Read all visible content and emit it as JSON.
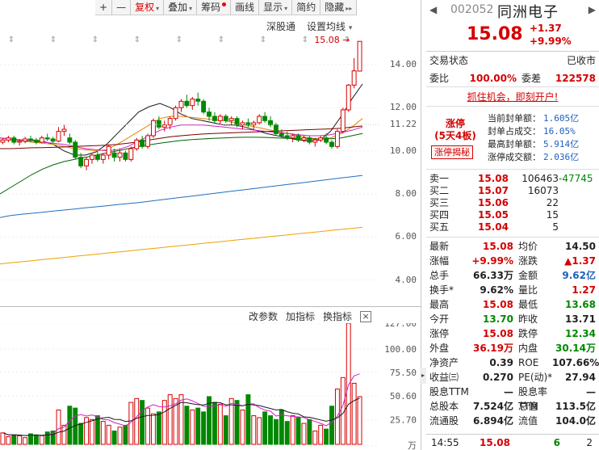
{
  "toolbar": {
    "items": [
      {
        "label": "+",
        "name": "zoom-in-button"
      },
      {
        "label": "—",
        "name": "zoom-out-button"
      },
      {
        "label": "复权",
        "name": "fuquan-dropdown",
        "caret": "▾",
        "red": true
      },
      {
        "label": "叠加",
        "name": "overlay-dropdown",
        "caret": "▾"
      },
      {
        "label": "筹码",
        "name": "chips-button",
        "dot": true
      },
      {
        "label": "画线",
        "name": "draw-line-button"
      },
      {
        "label": "显示",
        "name": "display-dropdown",
        "caret": "▾"
      },
      {
        "label": "简约",
        "name": "simple-button"
      },
      {
        "label": "隐藏",
        "name": "hide-button",
        "caret": "▸▸"
      }
    ]
  },
  "kline": {
    "index_label": "深股通",
    "ma_setting": "设置均线",
    "ma_caret": "▾",
    "price_ticks": [
      "14.00",
      "12.00",
      "11.22",
      "10.00",
      "8.00",
      "6.00",
      "4.00"
    ],
    "top_price_label": "15.08"
  },
  "volume": {
    "menu": [
      "改参数",
      "加指标",
      "换指标"
    ],
    "close": "×",
    "ticks": [
      "127.00",
      "100.00",
      "75.50",
      "50.60",
      "25.70",
      "万"
    ]
  },
  "chart_data": {
    "type": "candlestick",
    "ylim_price": [
      3.5,
      15.5
    ],
    "ylim_volume": [
      0,
      127
    ],
    "candles": [
      [
        10.4,
        10.6,
        10.3,
        10.5
      ],
      [
        10.5,
        10.7,
        10.4,
        10.6
      ],
      [
        10.6,
        10.7,
        10.3,
        10.4
      ],
      [
        10.4,
        10.55,
        10.25,
        10.45
      ],
      [
        10.45,
        10.65,
        10.35,
        10.55
      ],
      [
        10.55,
        10.7,
        10.4,
        10.5
      ],
      [
        10.5,
        10.6,
        10.3,
        10.4
      ],
      [
        10.4,
        10.7,
        10.35,
        10.6
      ],
      [
        10.6,
        10.8,
        10.45,
        10.55
      ],
      [
        10.55,
        10.65,
        10.35,
        10.45
      ],
      [
        10.45,
        11.1,
        10.4,
        10.9
      ],
      [
        10.9,
        11.2,
        10.7,
        11.0
      ],
      [
        10.6,
        10.8,
        10.3,
        10.4
      ],
      [
        10.4,
        10.5,
        9.6,
        9.7
      ],
      [
        9.7,
        9.9,
        9.2,
        9.3
      ],
      [
        9.3,
        9.7,
        9.1,
        9.6
      ],
      [
        9.6,
        9.9,
        9.4,
        9.8
      ],
      [
        9.8,
        10.0,
        9.5,
        9.6
      ],
      [
        9.6,
        9.9,
        9.4,
        9.8
      ],
      [
        9.8,
        10.3,
        9.6,
        10.2
      ],
      [
        9.9,
        10.1,
        9.5,
        9.7
      ],
      [
        9.7,
        10.1,
        9.5,
        9.9
      ],
      [
        9.9,
        10.0,
        9.5,
        9.6
      ],
      [
        9.6,
        10.2,
        9.5,
        10.1
      ],
      [
        10.1,
        10.6,
        10.0,
        10.5
      ],
      [
        10.5,
        10.7,
        10.1,
        10.2
      ],
      [
        10.2,
        10.8,
        10.1,
        10.7
      ],
      [
        10.7,
        11.5,
        10.6,
        11.4
      ],
      [
        11.4,
        11.6,
        11.0,
        11.1
      ],
      [
        11.1,
        11.4,
        10.9,
        11.2
      ],
      [
        11.2,
        11.6,
        11.0,
        11.5
      ],
      [
        11.5,
        12.1,
        11.4,
        12.0
      ],
      [
        12.0,
        12.4,
        11.8,
        12.3
      ],
      [
        12.3,
        12.6,
        12.0,
        12.1
      ],
      [
        12.1,
        12.5,
        11.9,
        12.4
      ],
      [
        12.4,
        12.7,
        12.1,
        12.3
      ],
      [
        12.3,
        12.4,
        11.7,
        11.8
      ],
      [
        11.8,
        12.0,
        11.4,
        11.6
      ],
      [
        11.6,
        11.8,
        11.3,
        11.4
      ],
      [
        11.4,
        11.7,
        11.2,
        11.6
      ],
      [
        11.6,
        11.7,
        11.3,
        11.4
      ],
      [
        11.4,
        11.6,
        11.2,
        11.5
      ],
      [
        11.5,
        11.6,
        11.1,
        11.2
      ],
      [
        11.2,
        11.4,
        11.0,
        11.3
      ],
      [
        11.3,
        11.5,
        11.1,
        11.2
      ],
      [
        11.2,
        11.4,
        11.0,
        11.3
      ],
      [
        11.3,
        11.7,
        11.2,
        11.6
      ],
      [
        11.6,
        11.8,
        11.3,
        11.4
      ],
      [
        11.4,
        11.6,
        11.1,
        11.2
      ],
      [
        11.2,
        11.3,
        10.7,
        10.8
      ],
      [
        10.8,
        11.0,
        10.6,
        10.7
      ],
      [
        10.7,
        10.9,
        10.5,
        10.6
      ],
      [
        10.6,
        10.8,
        10.4,
        10.7
      ],
      [
        10.7,
        10.8,
        10.4,
        10.5
      ],
      [
        10.5,
        10.7,
        10.4,
        10.6
      ],
      [
        10.6,
        10.7,
        10.3,
        10.4
      ],
      [
        10.4,
        10.6,
        10.2,
        10.5
      ],
      [
        10.5,
        10.7,
        10.4,
        10.6
      ],
      [
        10.6,
        10.8,
        10.3,
        10.4
      ],
      [
        10.4,
        10.5,
        10.1,
        10.2
      ],
      [
        10.2,
        11.0,
        10.1,
        10.9
      ],
      [
        10.9,
        12.0,
        10.8,
        11.9
      ],
      [
        11.9,
        13.1,
        11.8,
        13.05
      ],
      [
        13.05,
        14.3,
        12.9,
        13.71
      ],
      [
        13.7,
        15.08,
        13.68,
        15.08
      ]
    ],
    "volumes": [
      12,
      8,
      10,
      9,
      7,
      11,
      10,
      9,
      13,
      14,
      36,
      20,
      40,
      38,
      22,
      28,
      26,
      30,
      24,
      20,
      14,
      18,
      20,
      44,
      48,
      46,
      38,
      32,
      34,
      46,
      52,
      48,
      52,
      40,
      36,
      38,
      34,
      50,
      44,
      42,
      30,
      48,
      46,
      36,
      52,
      30,
      28,
      34,
      30,
      26,
      36,
      24,
      30,
      28,
      22,
      26,
      14,
      20,
      16,
      40,
      58,
      70,
      127,
      64,
      50
    ],
    "moving_averages": [
      {
        "color": "#1a1a1a",
        "values": [
          10.6,
          10.55,
          10.5,
          10.5,
          10.45,
          10.3,
          10.0,
          9.8,
          9.8,
          9.95,
          10.3,
          10.8,
          11.3,
          11.8,
          12.05,
          12.2,
          12.0,
          11.7,
          11.5,
          11.4,
          11.3,
          11.2,
          11.2,
          11.1,
          10.95,
          10.8,
          10.7,
          10.6,
          10.5,
          10.45,
          10.5,
          10.9,
          11.6,
          12.4,
          13.1
        ]
      },
      {
        "color": "#e08a00",
        "values": [
          10.5,
          10.5,
          10.45,
          10.4,
          10.35,
          10.3,
          10.2,
          10.1,
          10.05,
          10.0,
          10.05,
          10.3,
          10.6,
          10.9,
          11.2,
          11.5,
          11.6,
          11.6,
          11.55,
          11.5,
          11.45,
          11.4,
          11.3,
          11.2,
          11.1,
          11.0,
          10.9,
          10.8,
          10.7,
          10.6,
          10.55,
          10.6,
          10.8,
          11.1,
          11.5
        ]
      },
      {
        "color": "#d020c8",
        "values": [
          10.6,
          10.55,
          10.5,
          10.45,
          10.4,
          10.35,
          10.3,
          10.2,
          10.1,
          10.05,
          10.0,
          10.05,
          10.2,
          10.45,
          10.7,
          10.95,
          11.1,
          11.2,
          11.2,
          11.2,
          11.15,
          11.1,
          11.05,
          11.0,
          10.95,
          10.9,
          10.85,
          10.8,
          10.75,
          10.7,
          10.7,
          10.75,
          10.85,
          10.95,
          11.1
        ]
      },
      {
        "color": "#7a0000",
        "values": [
          10.1,
          10.1,
          10.12,
          10.14,
          10.15,
          10.16,
          10.18,
          10.2,
          10.22,
          10.24,
          10.26,
          10.3,
          10.35,
          10.42,
          10.5,
          10.58,
          10.65,
          10.7,
          10.74,
          10.78,
          10.8,
          10.82,
          10.84,
          10.86,
          10.88,
          10.9,
          10.92,
          10.94,
          10.96,
          10.98,
          11.0,
          11.02,
          11.05,
          11.1,
          11.15
        ]
      },
      {
        "color": "#006400",
        "values": [
          8.0,
          8.3,
          8.6,
          8.9,
          9.15,
          9.35,
          9.5,
          9.6,
          9.7,
          9.8,
          9.9,
          10.0,
          10.1,
          10.2,
          10.28,
          10.35,
          10.42,
          10.48,
          10.52,
          10.55,
          10.58,
          10.6,
          10.62,
          10.63,
          10.63,
          10.62,
          10.6,
          10.58,
          10.56,
          10.55,
          10.55,
          10.56,
          10.6,
          10.7,
          10.8
        ]
      },
      {
        "color": "#1f6fbf",
        "values": [
          6.9,
          7.0,
          7.05,
          7.1,
          7.15,
          7.2,
          7.25,
          7.3,
          7.35,
          7.4,
          7.45,
          7.5,
          7.55,
          7.6,
          7.66,
          7.72,
          7.78,
          7.84,
          7.9,
          7.96,
          8.02,
          8.08,
          8.14,
          8.2,
          8.26,
          8.32,
          8.38,
          8.44,
          8.5,
          8.56,
          8.62,
          8.68,
          8.74,
          8.8,
          8.86
        ]
      },
      {
        "color": "#f0a000",
        "values": [
          4.75,
          4.8,
          4.85,
          4.9,
          4.95,
          5.0,
          5.05,
          5.1,
          5.15,
          5.2,
          5.25,
          5.3,
          5.35,
          5.4,
          5.45,
          5.5,
          5.55,
          5.6,
          5.65,
          5.7,
          5.75,
          5.8,
          5.85,
          5.9,
          5.95,
          6.0,
          6.05,
          6.1,
          6.15,
          6.2,
          6.25,
          6.3,
          6.35,
          6.4,
          6.45
        ]
      }
    ]
  },
  "panel": {
    "code": "002052",
    "name": "同洲电子",
    "price": "15.08",
    "change": "+1.37",
    "change_pct": "+9.99%",
    "status_label": "交易状态",
    "status_value": "已收市",
    "weibi_label": "委比",
    "weibi_value": "100.00%",
    "weicha_label": "委差",
    "weicha_value": "122578",
    "promo": "抓住机会，即刻开户!",
    "limit_title": "涨停",
    "limit_sub": "(5天4板)",
    "limit_button": "涨停揭秘",
    "limit_rows": [
      {
        "label": "当前封单额：",
        "value": "1.605亿"
      },
      {
        "label": "封单占成交：",
        "value": "16.05%"
      },
      {
        "label": "最高封单额：",
        "value": "5.914亿"
      },
      {
        "label": "涨停成交额：",
        "value": "2.036亿"
      }
    ],
    "bids": [
      {
        "label": "卖一",
        "price": "15.08",
        "qty": "106463",
        "extra": "-47745"
      },
      {
        "label": "买二",
        "price": "15.07",
        "qty": "16073",
        "extra": ""
      },
      {
        "label": "买三",
        "price": "15.06",
        "qty": "22",
        "extra": ""
      },
      {
        "label": "买四",
        "price": "15.05",
        "qty": "15",
        "extra": ""
      },
      {
        "label": "买五",
        "price": "15.04",
        "qty": "5",
        "extra": ""
      }
    ],
    "stats": [
      {
        "l1": "最新",
        "v1": "15.08",
        "c1": "red",
        "l2": "均价",
        "v2": "14.50",
        "c2": "dark"
      },
      {
        "l1": "涨幅",
        "v1": "+9.99%",
        "c1": "red",
        "l2": "涨跌",
        "v2": "▲1.37",
        "c2": "red"
      },
      {
        "l1": "总手",
        "v1": "66.33万",
        "c1": "dark",
        "l2": "金额",
        "v2": "9.62亿",
        "c2": "blue"
      },
      {
        "l1": "换手*",
        "v1": "9.62%",
        "c1": "dark",
        "l2": "量比",
        "v2": "1.27",
        "c2": "red"
      },
      {
        "l1": "最高",
        "v1": "15.08",
        "c1": "red",
        "l2": "最低",
        "v2": "13.68",
        "c2": "green"
      },
      {
        "l1": "今开",
        "v1": "13.70",
        "c1": "green",
        "l2": "昨收",
        "v2": "13.71",
        "c2": "dark"
      },
      {
        "l1": "涨停",
        "v1": "15.08",
        "c1": "red",
        "l2": "跌停",
        "v2": "12.34",
        "c2": "green"
      },
      {
        "l1": "外盘",
        "v1": "36.19万",
        "c1": "red",
        "l2": "内盘",
        "v2": "30.14万",
        "c2": "green"
      },
      {
        "l1": "净资产",
        "v1": "0.39",
        "c1": "dark",
        "l2": "ROE",
        "v2": "107.66%",
        "c2": "dark"
      },
      {
        "l1": "收益㈢",
        "v1": "0.270",
        "c1": "dark",
        "l2": "PE(动)*",
        "v2": "27.94",
        "c2": "dark"
      },
      {
        "l1": "股息TTM",
        "v1": "—",
        "c1": "dark",
        "l2": "股息率TTM",
        "v2": "—",
        "c2": "dark"
      },
      {
        "l1": "总股本",
        "v1": "7.524亿",
        "c1": "dark",
        "l2": "总值",
        "v2": "113.5亿",
        "c2": "dark"
      },
      {
        "l1": "流通股",
        "v1": "6.894亿",
        "c1": "dark",
        "l2": "流值",
        "v2": "104.0亿",
        "c2": "dark"
      }
    ],
    "tick": {
      "time": "14:55",
      "price": "15.08",
      "vol": "6",
      "count": "2"
    }
  },
  "colors": {
    "up": "#d40000",
    "down": "#008800",
    "blue": "#1f5fbd"
  }
}
